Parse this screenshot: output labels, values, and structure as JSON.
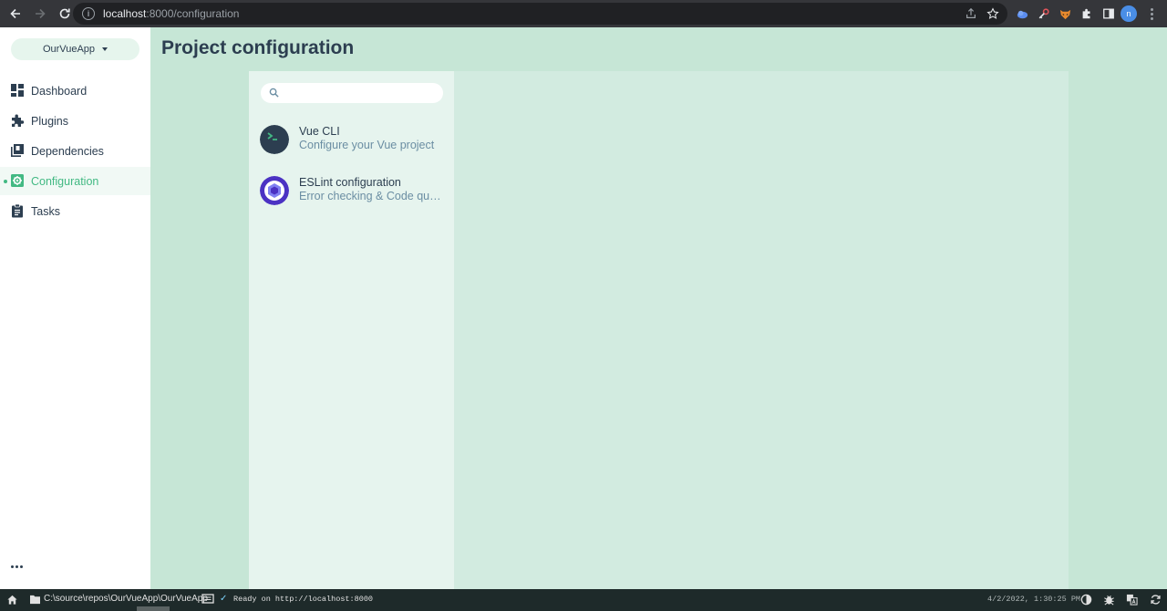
{
  "browser": {
    "url_host": "localhost",
    "url_path": ":8000/configuration",
    "profile_initial": "n"
  },
  "app": {
    "project_name": "OurVueApp",
    "nav": [
      {
        "label": "Dashboard",
        "icon": "dashboard-icon",
        "active": false
      },
      {
        "label": "Plugins",
        "icon": "puzzle-icon",
        "active": false
      },
      {
        "label": "Dependencies",
        "icon": "library-icon",
        "active": false
      },
      {
        "label": "Configuration",
        "icon": "settings-applications-icon",
        "active": true
      },
      {
        "label": "Tasks",
        "icon": "clipboard-icon",
        "active": false
      }
    ],
    "page_title": "Project configuration",
    "search_placeholder": "",
    "configurations": [
      {
        "name": "Vue CLI",
        "description": "Configure your Vue project",
        "icon": "vue-cli-terminal-icon"
      },
      {
        "name": "ESLint configuration",
        "description": "Error checking & Code quality",
        "icon": "eslint-icon"
      }
    ]
  },
  "statusbar": {
    "path": "C:\\source\\repos\\OurVueApp\\OurVueApp",
    "message": "Ready on http://localhost:8000",
    "timestamp": "4/2/2022, 1:30:25 PM"
  },
  "colors": {
    "accent": "#42b983",
    "text": "#2c3e50",
    "content_bg": "#c6e6d6",
    "statusbar_bg": "#1e2a2a"
  }
}
